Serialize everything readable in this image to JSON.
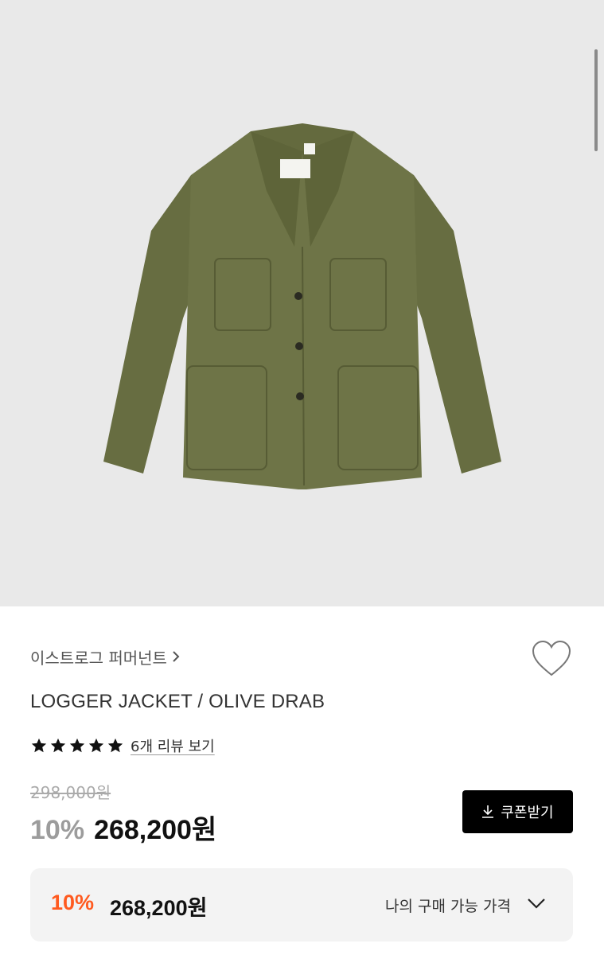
{
  "product": {
    "brand_link": "이스트로그 퍼머넌트",
    "name": "LOGGER JACKET / OLIVE DRAB",
    "rating_stars": 5,
    "review_link": "6개 리뷰 보기",
    "original_price": "298,000원",
    "discount_rate": "10%",
    "sale_price": "268,200원"
  },
  "coupon": {
    "label": "쿠폰받기",
    "icon": "download-icon"
  },
  "my_price": {
    "discount_rate": "10%",
    "price": "268,200원",
    "label": "나의 구매 가능 가격",
    "icon": "chevron-down-icon"
  },
  "colors": {
    "accent_discount": "#ff5a1f",
    "coupon_bg": "#000000",
    "jacket": "#6e7447",
    "hero_bg": "#e9e9e9"
  }
}
